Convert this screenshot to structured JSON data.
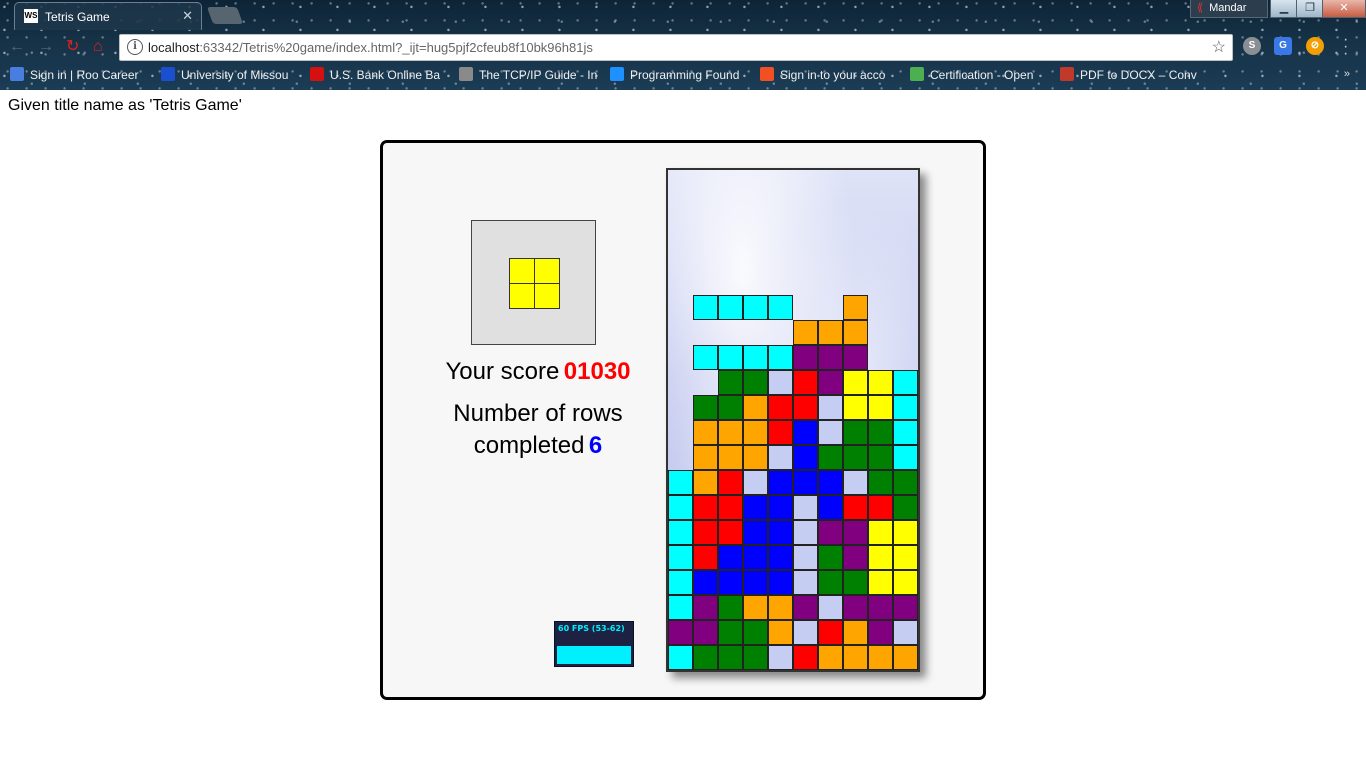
{
  "browser": {
    "tab_title": "Tetris Game",
    "tab_favicon": "WS",
    "user_name": "Mandar",
    "url_host": "localhost",
    "url_rest": ":63342/Tetris%20game/index.html?_ijt=hug5pjf2cfeub8f10bk96h81js",
    "bookmarks": [
      {
        "label": "Sign in | Roo Career",
        "color": "#4a7de0"
      },
      {
        "label": "University of Missou",
        "color": "#1a4fd0"
      },
      {
        "label": "U.S. Bank Online Ba",
        "color": "#d41010"
      },
      {
        "label": "The TCP/IP Guide - In",
        "color": "#8a8a8a"
      },
      {
        "label": "Programming Found",
        "color": "#1e90ff"
      },
      {
        "label": "Sign in to your acco",
        "color": "#f25022"
      },
      {
        "label": "Certification - Open",
        "color": "#4caf50"
      },
      {
        "label": "PDF to DOCX – Conv",
        "color": "#c0392b"
      }
    ],
    "bookmarks_more": "»",
    "icons": [
      "back-icon",
      "forward-icon",
      "reload-icon",
      "home-icon",
      "info-icon",
      "star-icon",
      "menu-icon"
    ]
  },
  "page": {
    "note": "Given title name as 'Tetris Game'"
  },
  "game": {
    "score_label": "Your score",
    "score": "01030",
    "rows_label_line1": "Number of rows",
    "rows_label_line2": "completed",
    "rows": "6",
    "fps_label": "60 FPS (53-62)",
    "next_piece": "O",
    "colors": {
      "I": "#00ffff",
      "O": "#ffff00",
      "T": "#800080",
      "L": "#ffa500",
      "J": "#0000ff",
      "S": "#008000",
      "Z": "#ff0000",
      "ghost": "#c6cdf2"
    },
    "board_rows": [
      "..........",
      "..........",
      "..........",
      "..........",
      "..........",
      ".IIII..L..",
      ".....LLL..",
      ".IIIITTT..",
      "..SSgZTOOI",
      ".SSLZZgOOI",
      ".LLLZJgSSI",
      ".LLLgJSSSI",
      "ILZgJJJgSS",
      "IZZJJgJZZS",
      "IZZJJgTTOO",
      "IZJJJgSTOO",
      "IJJJJgSSOO",
      "ITSLLTgTTT",
      "TTSSLgZLTg",
      "ISSSgZLLLL"
    ]
  }
}
